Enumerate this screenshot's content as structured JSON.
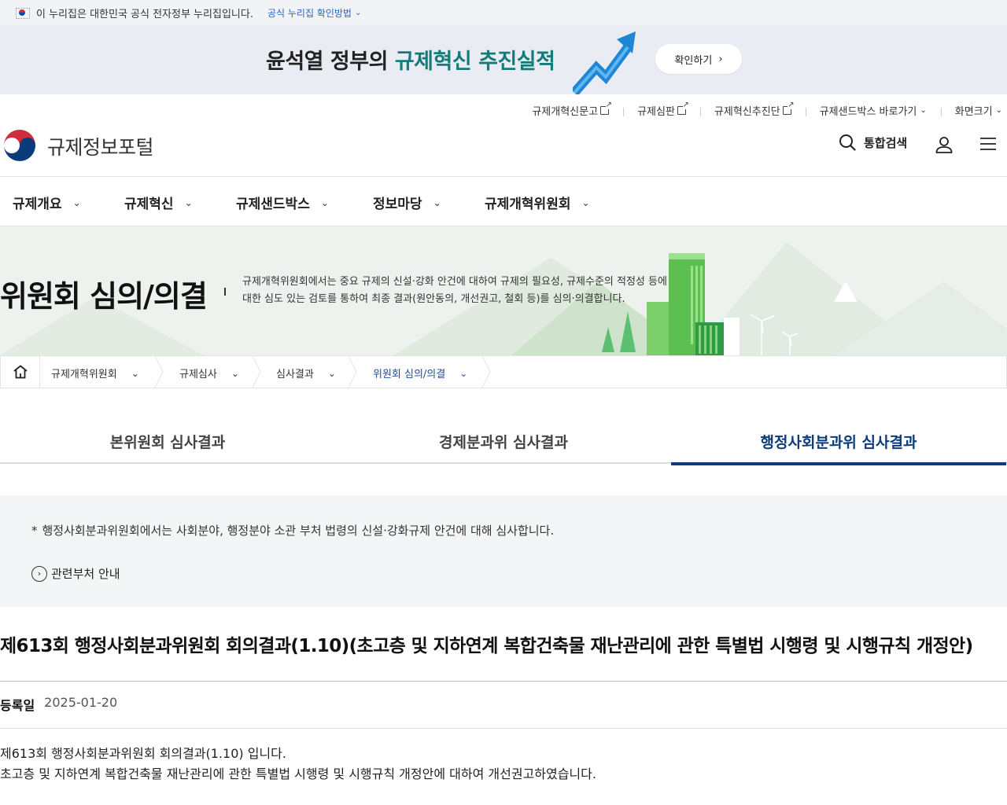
{
  "gov_banner": {
    "text": "이 누리집은 대한민국 공식 전자정부 누리집입니다.",
    "verify_link": "공식 누리집 확인방법"
  },
  "promo": {
    "title_part1": "윤석열 정부의 ",
    "title_highlight": "규제혁신 추진실적",
    "button": "확인하기"
  },
  "utility_links": [
    {
      "label": "규제개혁신문고",
      "icon": "external-link-icon"
    },
    {
      "label": "규제심판",
      "icon": "external-link-icon"
    },
    {
      "label": "규제혁신추진단",
      "icon": "external-link-icon"
    },
    {
      "label": "규제샌드박스 바로가기",
      "icon": "chevron-down-icon"
    },
    {
      "label": "화면크기",
      "icon": "chevron-down-icon"
    }
  ],
  "header": {
    "site_name": "규제정보포털",
    "search_label": "통합검색"
  },
  "gnb": [
    {
      "label": "규제개요"
    },
    {
      "label": "규제혁신"
    },
    {
      "label": "규제샌드박스"
    },
    {
      "label": "정보마당"
    },
    {
      "label": "규제개혁위원회"
    }
  ],
  "visual": {
    "title": "위원회 심의/의결",
    "desc_line1": "규제개혁위원회에서는 중요 규제의 신설·강화 안건에 대하여 규제의 필요성, 규제수준의 적정성 등에",
    "desc_line2": "대한 심도 있는 검토를 통하여 최종 결과(원안동의, 개선권고, 철회 등)를 심의·의결합니다."
  },
  "breadcrumb": [
    {
      "label": "규제개혁위원회"
    },
    {
      "label": "규제심사"
    },
    {
      "label": "심사결과"
    },
    {
      "label": "위원회 심의/의결"
    }
  ],
  "tabs": [
    {
      "label": "본위원회 심사결과",
      "active": false
    },
    {
      "label": "경제분과위 심사결과",
      "active": false
    },
    {
      "label": "행정사회분과위 심사결과",
      "active": true
    }
  ],
  "info": {
    "note": "행정사회분과위원회에서는 사회분야, 행정분야 소관 부처 법령의 신설·강화규제 안건에 대해 심사합니다.",
    "related": "관련부처 안내"
  },
  "article": {
    "title": "제613회 행정사회분과위원회 회의결과(1.10)(초고층 및 지하연계 복합건축물 재난관리에 관한 특별법 시행령 및 시행규칙 개정안)",
    "date_label": "등록일",
    "date": "2025-01-20",
    "body_line1": "제613회 행정사회분과위원회 회의결과(1.10) 입니다.",
    "body_line2": "초고층 및 지하연계 복합건축물 재난관리에 관한 특별법 시행령 및 시행규칙 개정안에 대하여 개선권고하였습니다."
  },
  "colors": {
    "brand_navy": "#0b3b7a",
    "promo_highlight": "#147a7a",
    "link_blue": "#2a64c8"
  }
}
